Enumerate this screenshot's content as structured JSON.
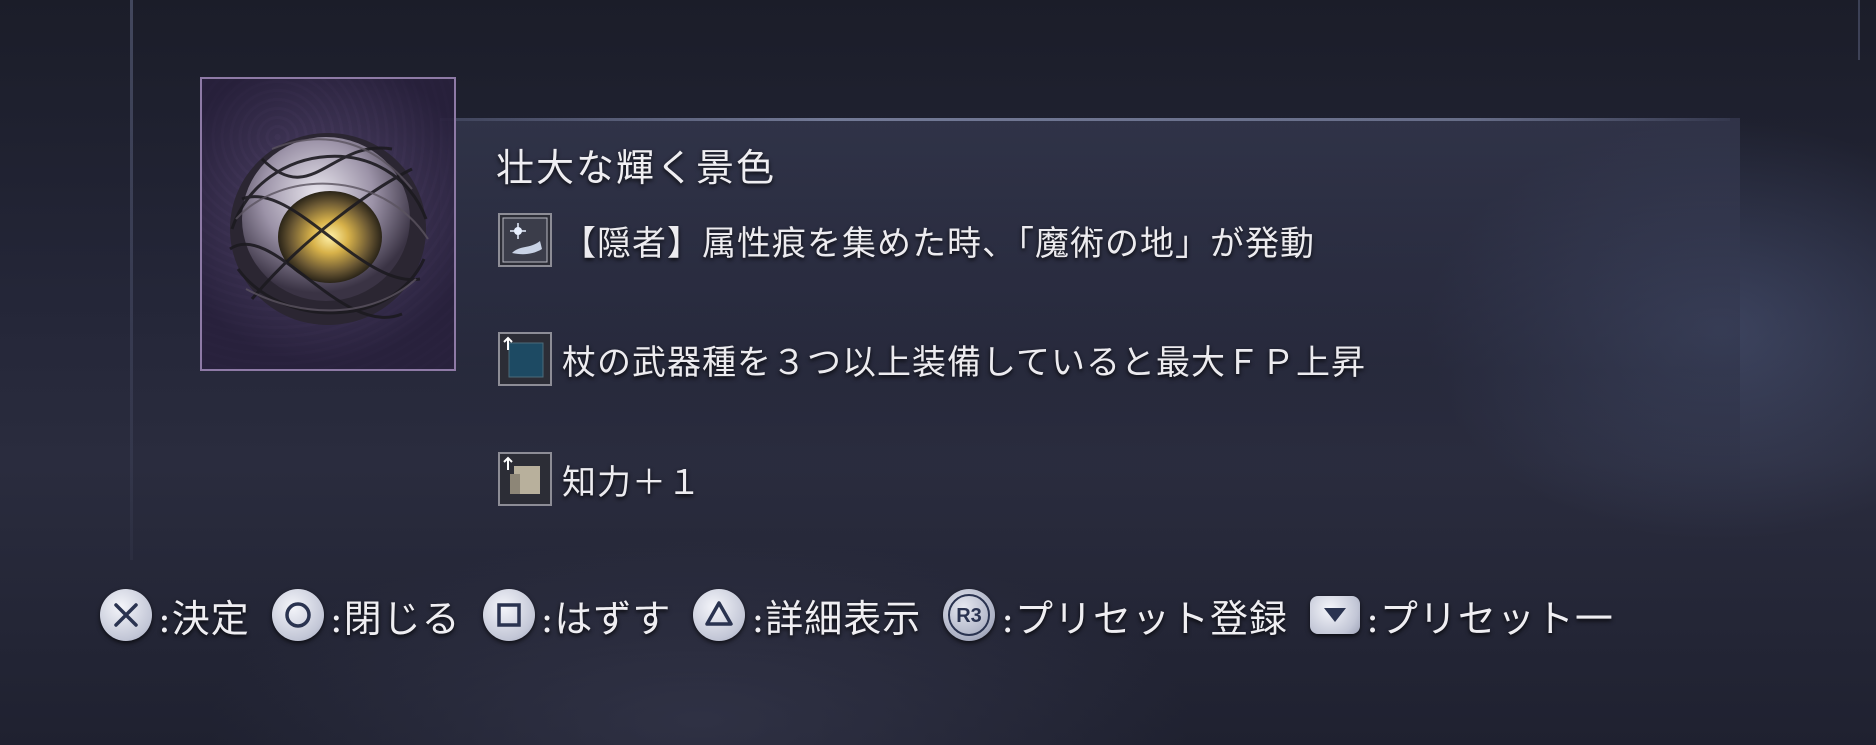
{
  "relic": {
    "name": "壮大な輝く景色",
    "effects": [
      {
        "icon": "hermit-magic-icon",
        "text": "【隠者】属性痕を集めた時、「魔術の地」が発動"
      },
      {
        "icon": "stat-up-blue-icon",
        "text": "杖の武器種を３つ以上装備していると最大ＦＰ上昇"
      },
      {
        "icon": "stat-up-scroll-icon",
        "text": "知力＋１"
      }
    ]
  },
  "controls": [
    {
      "button": "cross-button-icon",
      "label": ":決定"
    },
    {
      "button": "circle-button-icon",
      "label": ":閉じる"
    },
    {
      "button": "square-button-icon",
      "label": ":はずす"
    },
    {
      "button": "triangle-button-icon",
      "label": ":詳細表示"
    },
    {
      "button": "r3-button-icon",
      "glyph": "R3",
      "label": ":プリセット登録"
    },
    {
      "button": "dpad-down-icon",
      "label": ":プリセット一"
    }
  ],
  "colors": {
    "background": "#1f2130",
    "relic_frame": "#8e7aa6",
    "text": "#efeef2"
  }
}
